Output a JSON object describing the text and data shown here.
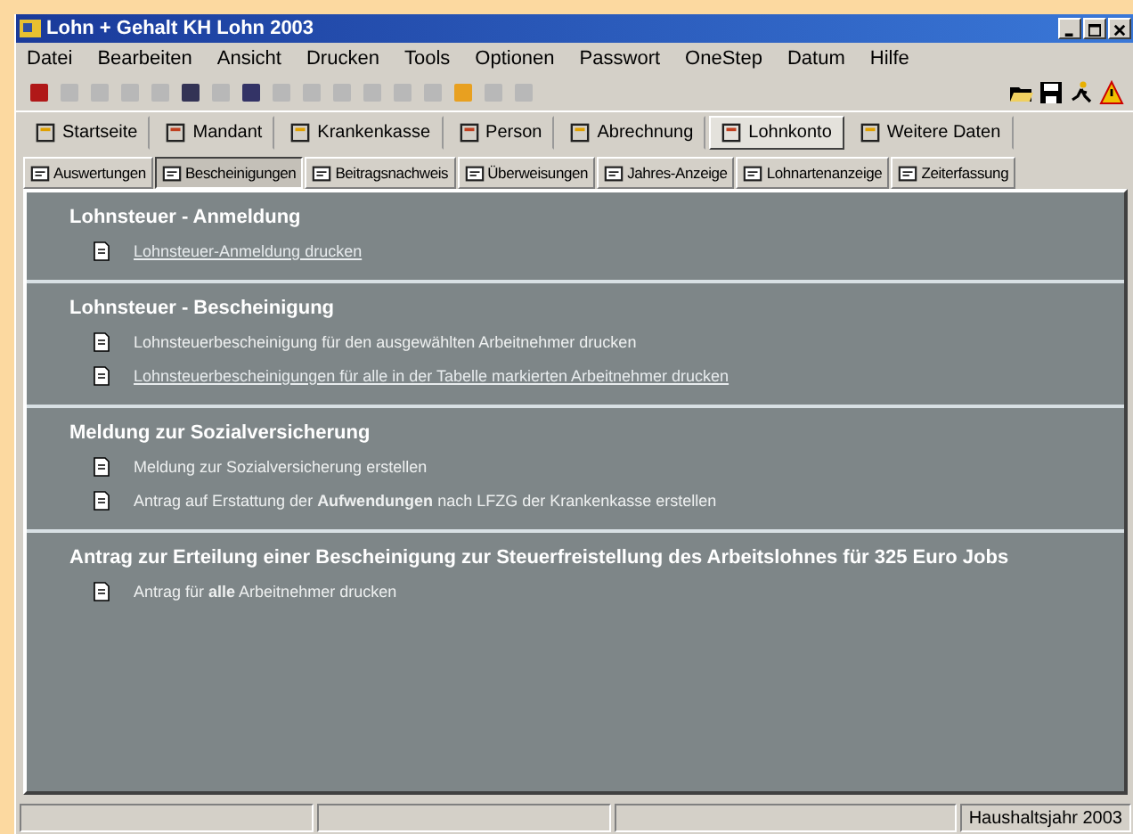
{
  "window": {
    "title": "Lohn + Gehalt KH Lohn 2003"
  },
  "menu": [
    "Datei",
    "Bearbeiten",
    "Ansicht",
    "Drucken",
    "Tools",
    "Optionen",
    "Passwort",
    "OneStep",
    "Datum",
    "Hilfe"
  ],
  "toolbar": [
    {
      "disabled": false
    },
    {
      "disabled": true
    },
    {
      "disabled": true
    },
    {
      "disabled": true
    },
    {
      "disabled": true
    },
    {
      "disabled": false
    },
    {
      "disabled": true
    },
    {
      "disabled": false
    },
    {
      "disabled": true
    },
    {
      "disabled": true
    },
    {
      "disabled": true
    },
    {
      "disabled": true
    },
    {
      "disabled": true
    },
    {
      "disabled": true
    },
    {
      "disabled": false
    },
    {
      "disabled": true
    },
    {
      "disabled": true
    }
  ],
  "main_tabs": [
    {
      "label": "Startseite",
      "selected": false
    },
    {
      "label": "Mandant",
      "selected": false
    },
    {
      "label": "Krankenkasse",
      "selected": false
    },
    {
      "label": "Person",
      "selected": false
    },
    {
      "label": "Abrechnung",
      "selected": false
    },
    {
      "label": "Lohnkonto",
      "selected": true
    },
    {
      "label": "Weitere Daten",
      "selected": false
    }
  ],
  "sub_tabs": [
    {
      "label": "Auswertungen",
      "selected": false
    },
    {
      "label": "Bescheinigungen",
      "selected": true
    },
    {
      "label": "Beitragsnachweis",
      "selected": false
    },
    {
      "label": "Überweisungen",
      "selected": false
    },
    {
      "label": "Jahres-Anzeige",
      "selected": false
    },
    {
      "label": "Lohnartenanzeige",
      "selected": false
    },
    {
      "label": "Zeiterfassung",
      "selected": false
    }
  ],
  "sections": [
    {
      "title": "Lohnsteuer - Anmeldung",
      "items": [
        {
          "kind": "link",
          "text": "Lohnsteuer-Anmeldung drucken"
        }
      ]
    },
    {
      "title": "Lohnsteuer - Bescheinigung",
      "items": [
        {
          "kind": "action",
          "text": "Lohnsteuerbescheinigung für den ausgewählten Arbeitnehmer drucken"
        },
        {
          "kind": "link",
          "text": "Lohnsteuerbescheinigungen für alle in der Tabelle markierten Arbeitnehmer drucken"
        }
      ]
    },
    {
      "title": "Meldung zur Sozialversicherung",
      "items": [
        {
          "kind": "action",
          "text": "Meldung zur Sozialversicherung erstellen"
        },
        {
          "kind": "action",
          "text": "Antrag auf Erstattung der **Aufwendungen** nach LFZG der Krankenkasse erstellen"
        }
      ]
    },
    {
      "title": "Antrag zur Erteilung einer Bescheinigung zur Steuerfreistellung des Arbeitslohnes für 325 Euro Jobs",
      "items": [
        {
          "kind": "action",
          "text": "Antrag für **alle** Arbeitnehmer drucken"
        }
      ]
    }
  ],
  "status_bar": {
    "panel_4": "Haushaltsjahr 2003"
  }
}
